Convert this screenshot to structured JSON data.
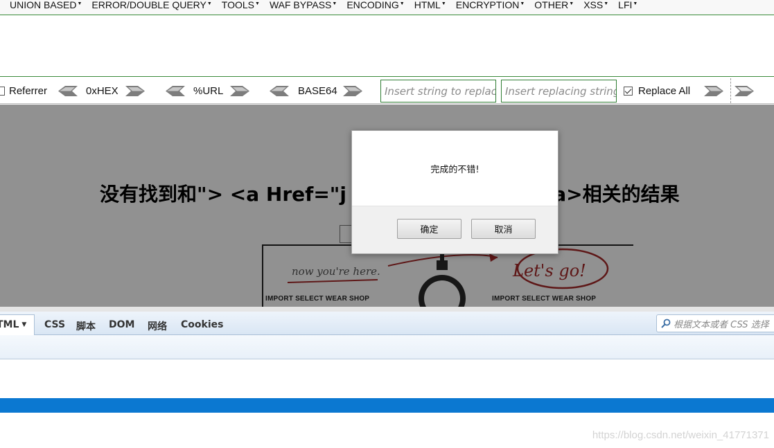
{
  "hackbar": {
    "menu": [
      {
        "label": "UNION BASED"
      },
      {
        "label": "ERROR/DOUBLE QUERY"
      },
      {
        "label": "TOOLS"
      },
      {
        "label": "WAF BYPASS"
      },
      {
        "label": "ENCODING"
      },
      {
        "label": "HTML"
      },
      {
        "label": "ENCRYPTION"
      },
      {
        "label": "OTHER"
      },
      {
        "label": "XSS"
      },
      {
        "label": "LFI"
      }
    ],
    "toolbar": {
      "referrer_label": "Referrer",
      "referrer_checked": false,
      "hex_label": "0xHEX",
      "url_label": "%URL",
      "base64_label": "BASE64",
      "replace_input_placeholder": "Insert string to replace",
      "replacing_input_placeholder": "Insert replacing string",
      "replace_all_label": "Replace All",
      "replace_all_checked": true
    }
  },
  "page": {
    "heading_left": "没有找到和\"> <a Href=\"j",
    "heading_right": ")\">link</a>相关的结果",
    "banner": {
      "now_here_text": "now you're here.",
      "lets_go_text": "Let's go!",
      "shop_left": "IMPORT SELECT WEAR SHOP",
      "shop_right": "IMPORT SELECT WEAR SHOP"
    }
  },
  "dialog": {
    "message": "完成的不错!",
    "ok_label": "确定",
    "cancel_label": "取消"
  },
  "devtools": {
    "tabs": [
      {
        "label": "TML"
      },
      {
        "label": "CSS"
      },
      {
        "label": "脚本"
      },
      {
        "label": "DOM"
      },
      {
        "label": "网络"
      },
      {
        "label": "Cookies"
      }
    ],
    "search_placeholder": "根据文本或者 CSS 选择"
  },
  "watermark": "https://blog.csdn.net/weixin_41771371",
  "colors": {
    "hackbar_green": "#2e7d32",
    "overlay": "rgba(0,0,0,0.43)",
    "taskbar_blue": "#0b78d1",
    "annotation_red": "#a52a2a"
  }
}
